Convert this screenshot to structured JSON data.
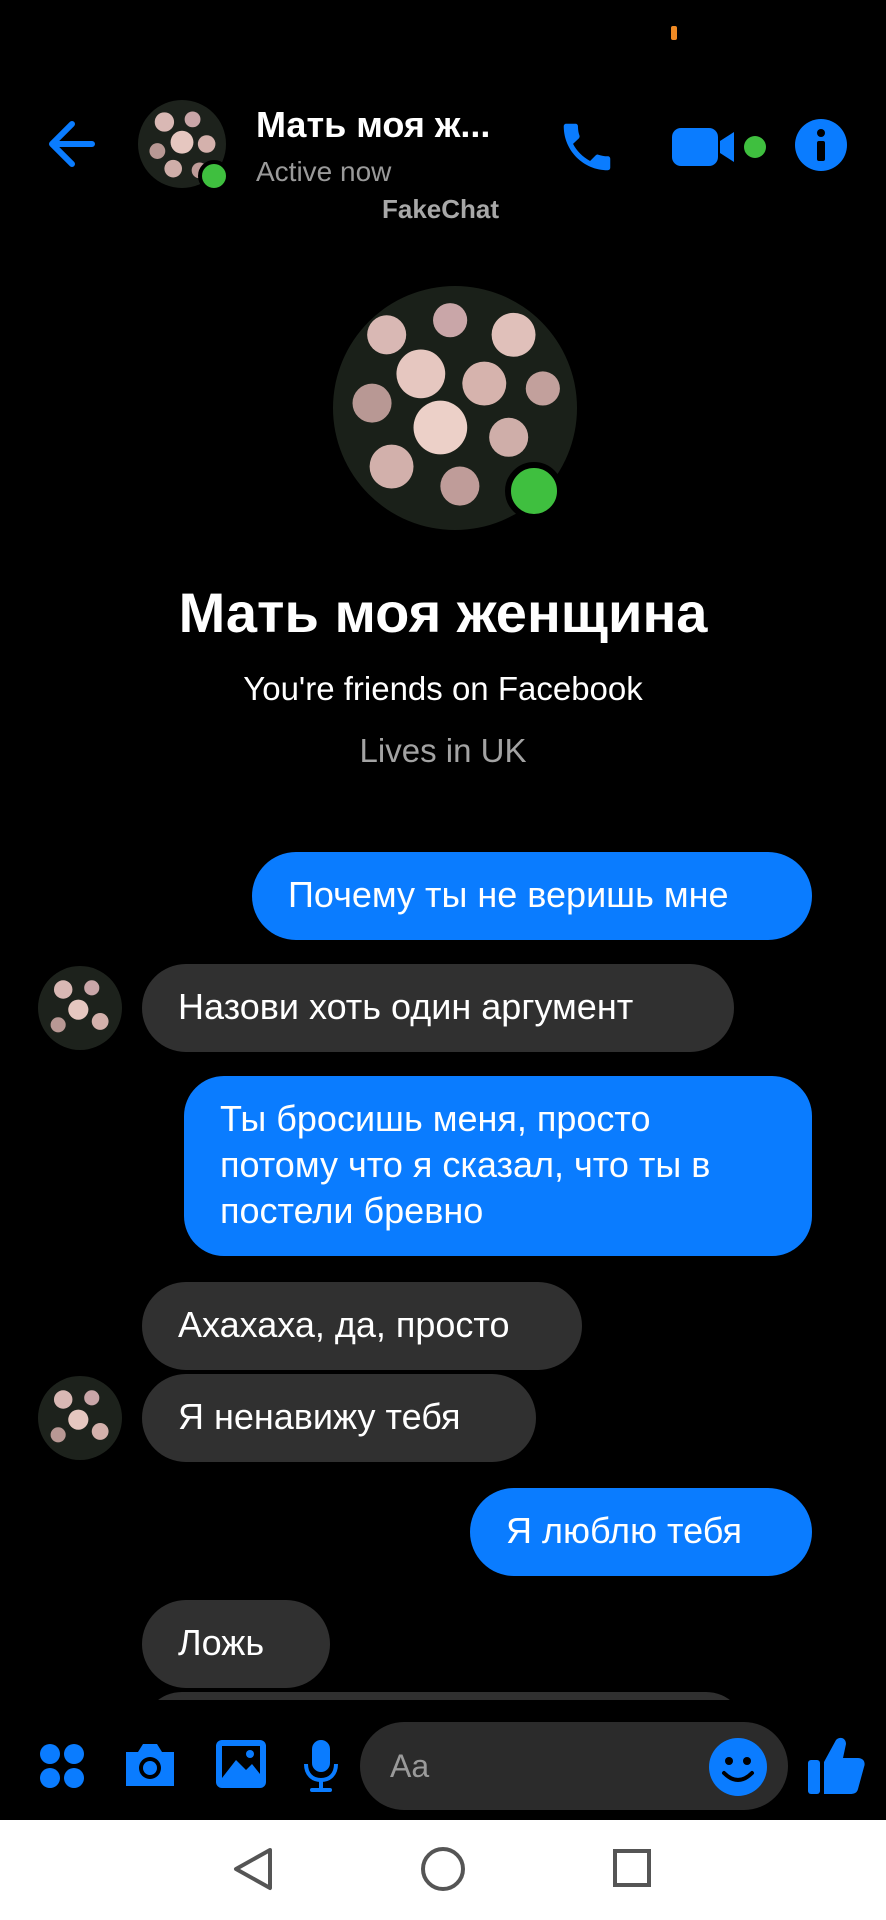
{
  "colors": {
    "accent": "#0a7cff",
    "background": "#000000",
    "incoming_bubble": "#303030",
    "online": "#3fbf3f"
  },
  "header": {
    "name": "Мать моя ж...",
    "status": "Active now",
    "watermark": "FakeChat",
    "icons": [
      "back-arrow-icon",
      "phone-icon",
      "video-camera-icon",
      "info-icon"
    ]
  },
  "profile": {
    "name": "Мать моя женщина",
    "friends_text": "You're friends on Facebook",
    "lives_text": "Lives in UK"
  },
  "messages": [
    {
      "direction": "outgoing",
      "text": "Почему ты не веришь мне"
    },
    {
      "direction": "incoming",
      "text": "Назови хоть один аргумент"
    },
    {
      "direction": "outgoing",
      "text": "Ты бросишь меня, просто потому что я сказал, что ты в постели бревно"
    },
    {
      "direction": "incoming",
      "text": "Ахахаха, да, просто"
    },
    {
      "direction": "incoming",
      "text": "Я ненавижу тебя"
    },
    {
      "direction": "outgoing",
      "text": "Я люблю тебя"
    },
    {
      "direction": "incoming",
      "text": "Ложь"
    }
  ],
  "composer": {
    "placeholder": "Aa",
    "icons": [
      "apps-grid-icon",
      "camera-icon",
      "image-icon",
      "microphone-icon",
      "emoji-icon",
      "thumbs-up-icon"
    ]
  },
  "navbar": {
    "icons": [
      "nav-back-icon",
      "nav-home-icon",
      "nav-recents-icon"
    ]
  }
}
